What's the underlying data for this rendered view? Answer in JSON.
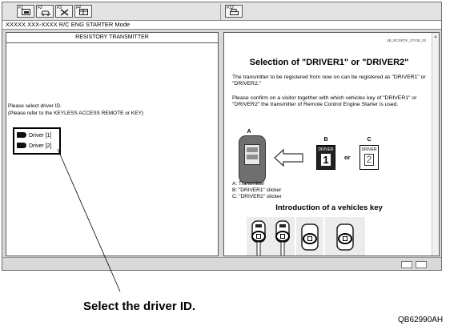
{
  "toolbar": {
    "buttons": [
      {
        "key": "F1",
        "icon": "screen-icon"
      },
      {
        "key": "F2",
        "icon": "car-icon"
      },
      {
        "key": "F3",
        "icon": "tools-icon"
      },
      {
        "key": "F4",
        "icon": "table-icon"
      },
      {
        "key": "F12",
        "icon": "print-icon"
      }
    ]
  },
  "mode_bar": {
    "text": "XXXXX XXX-XXXX R/C ENG STARTER Mode"
  },
  "left_pane": {
    "title": "RESISTORY TRANSMITTER",
    "instruction_1": "Please select driver ID.",
    "instruction_2": "(Please refer to the KEYLESS ACCESS REMOTE or KEY)",
    "drivers": [
      "Driver [1]",
      "Driver [2]"
    ]
  },
  "right_pane": {
    "doc_code": "4B_RCSRTK_CFOB_02",
    "title": "Selection of \"DRIVER1\" or \"DRIVER2\"",
    "para_1": "The transmitter to be registered from now on can be registered as \"DRIVER1\" or \"DRIVER2.\"",
    "para_2": "Please confirm on a visitor together with which vehicles key of \"DRIVER1\" or \"DRIVER2\" the transmitter of Remote Control Engine Starter is used.",
    "figure": {
      "label_a": "A",
      "label_b": "B",
      "label_c": "C",
      "sticker_b_text": "DRIVER",
      "sticker_b_num": "1",
      "sticker_c_text": "DRIVER",
      "sticker_c_num": "2",
      "or_text": "or"
    },
    "legend": [
      "A: Transmitter",
      "B: \"DRIVER1\" sticker",
      "C: \"DRIVER2\" sticker"
    ],
    "subtitle": "Introduction of a vehicles key"
  },
  "callout": {
    "text": "Select the driver ID."
  },
  "figure_code": "QB62990AH"
}
